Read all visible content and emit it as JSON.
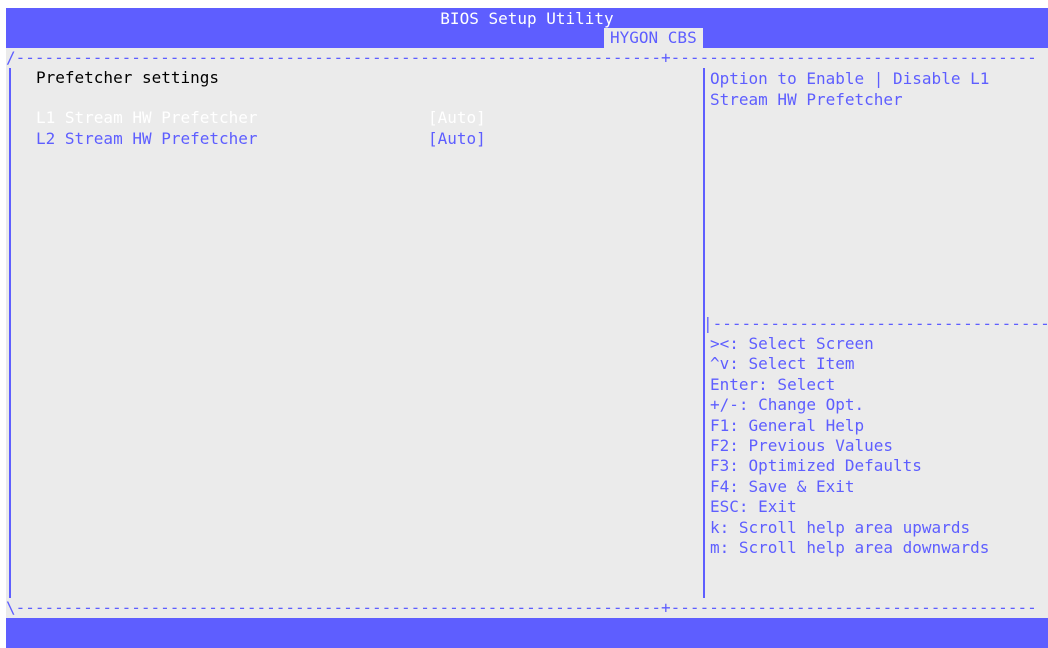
{
  "title": "BIOS Setup Utility",
  "active_tab": "HYGON CBS",
  "colors": {
    "accent": "#5e5eff",
    "background": "#ebebeb",
    "selected_text": "#ffffff",
    "heading_text": "#000000"
  },
  "menu": {
    "heading": "Prefetcher settings",
    "items": [
      {
        "label": "L1 Stream HW Prefetcher",
        "value": "[Auto]",
        "selected": true
      },
      {
        "label": "L2 Stream HW Prefetcher",
        "value": "[Auto]",
        "selected": false
      }
    ]
  },
  "help_text": "Option to Enable | Disable L1 Stream HW Prefetcher",
  "key_help": [
    "><: Select Screen",
    "^v: Select Item",
    "Enter: Select",
    "+/-: Change Opt.",
    "F1: General Help",
    "F2: Previous Values",
    "F3: Optimized Defaults",
    "F4: Save & Exit",
    "ESC: Exit",
    "k: Scroll help area upwards",
    "m: Scroll help area downwards"
  ]
}
